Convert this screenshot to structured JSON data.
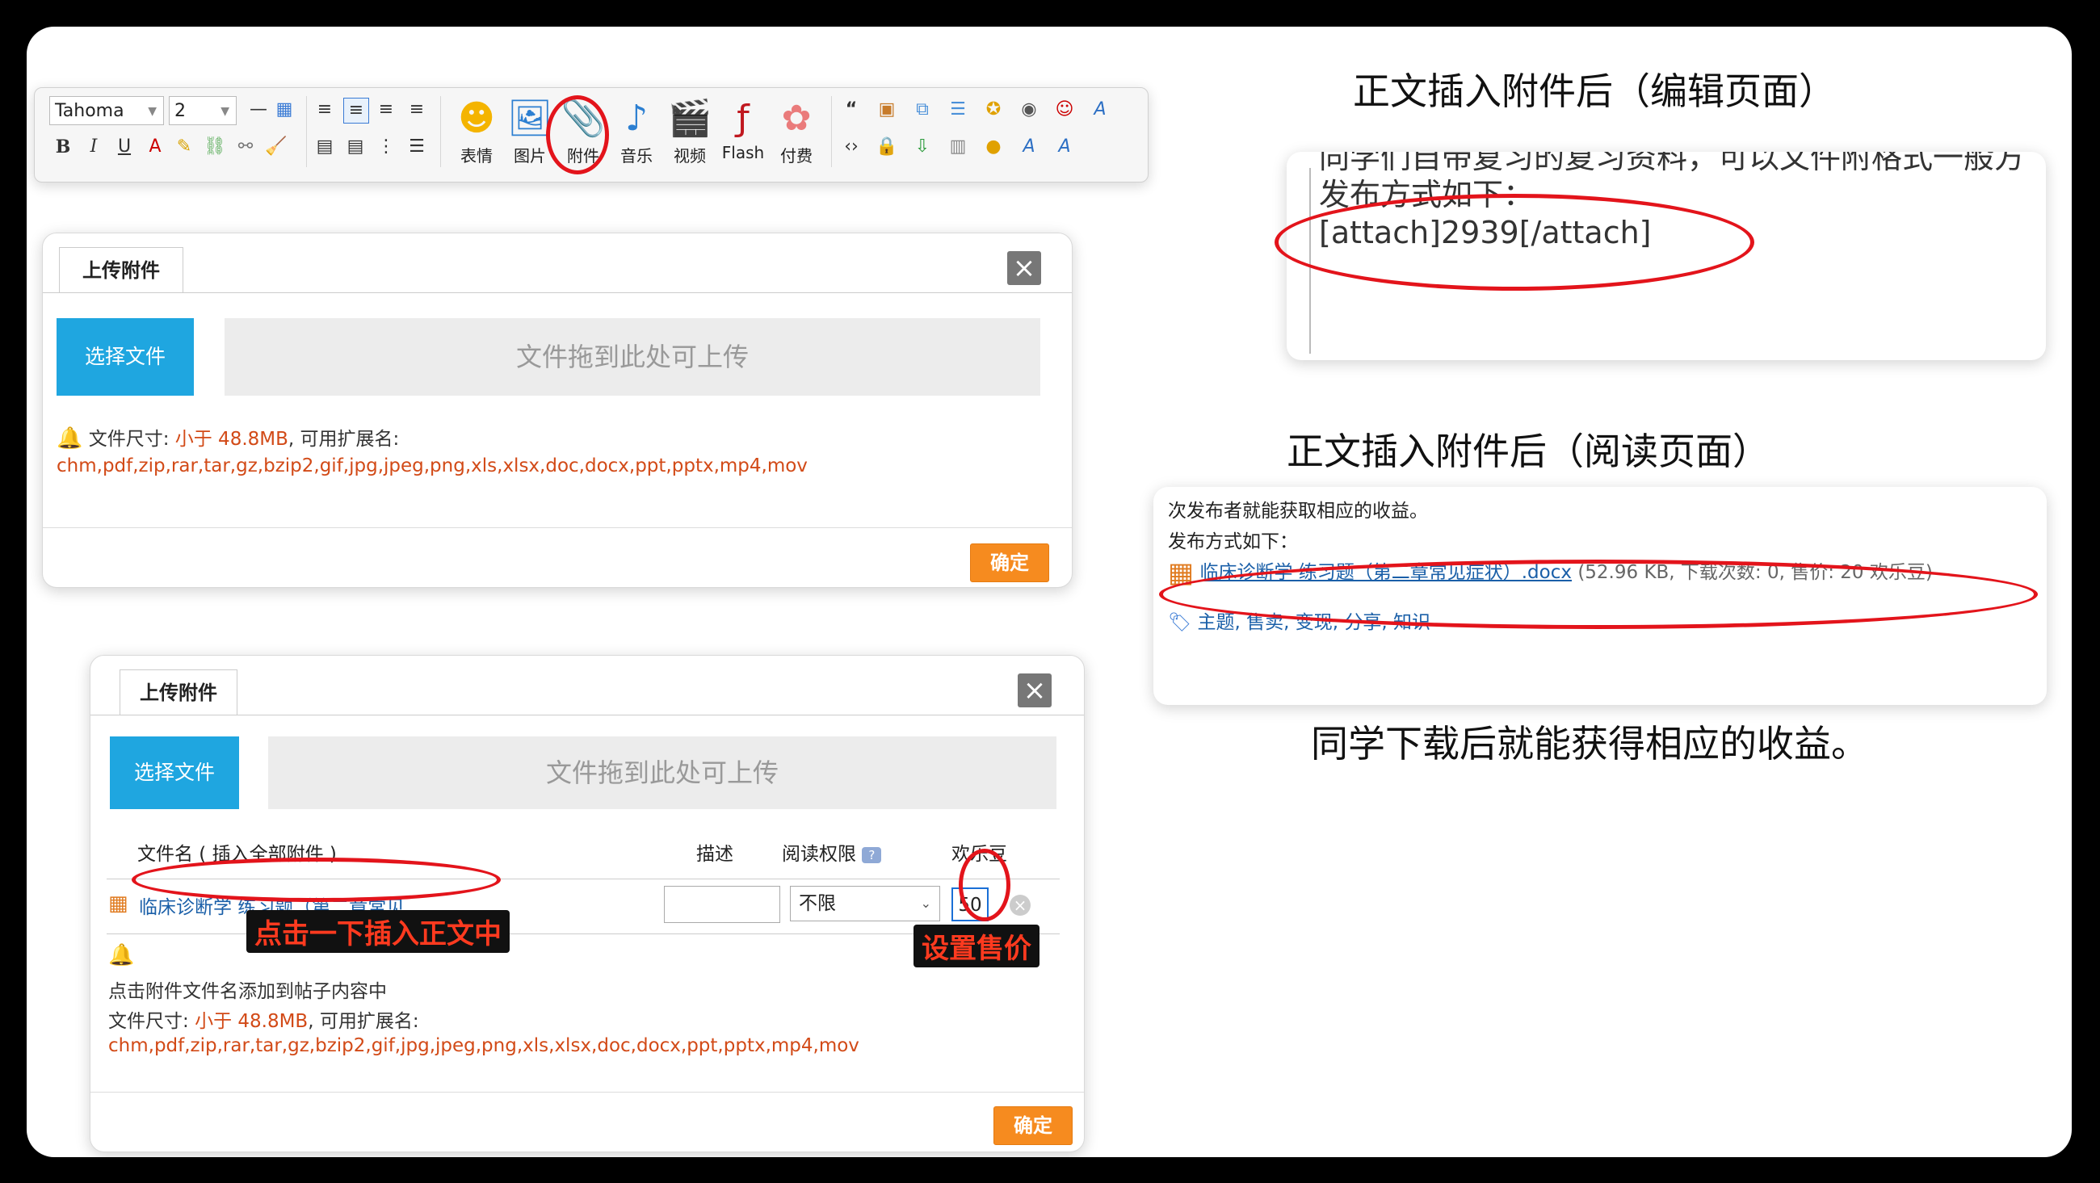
{
  "toolbar": {
    "font_value": "Tahoma",
    "size_value": "2",
    "buttons": [
      {
        "label": "表情",
        "icon": "smiley-icon"
      },
      {
        "label": "图片",
        "icon": "image-icon"
      },
      {
        "label": "附件",
        "icon": "paperclip-icon"
      },
      {
        "label": "音乐",
        "icon": "music-note-icon"
      },
      {
        "label": "视频",
        "icon": "video-icon"
      },
      {
        "label": "Flash",
        "icon": "flash-icon"
      },
      {
        "label": "付费",
        "icon": "paid-icon"
      }
    ]
  },
  "upload_dialog_1": {
    "tab": "上传附件",
    "choose_file": "选择文件",
    "dropzone": "文件拖到此处可上传",
    "size_prefix": "文件尺寸:",
    "size_limit": "小于 48.8MB",
    "ext_prefix": ", 可用扩展名:",
    "extensions": "chm,pdf,zip,rar,tar,gz,bzip2,gif,jpg,jpeg,png,xls,xlsx,doc,docx,ppt,pptx,mp4,mov",
    "ok": "确定"
  },
  "upload_dialog_2": {
    "tab": "上传附件",
    "choose_file": "选择文件",
    "dropzone": "文件拖到此处可上传",
    "columns": {
      "filename": "文件名 ( 插入全部附件 )",
      "desc": "描述",
      "permission": "阅读权限",
      "price": "欢乐豆"
    },
    "file": {
      "name": "临床诊断学 练习题（第二章常见 ...",
      "permission": "不限",
      "price": "50"
    },
    "hint": "点击附件文件名添加到帖子内容中",
    "size_prefix": "文件尺寸:",
    "size_limit": "小于 48.8MB",
    "ext_prefix": ", 可用扩展名:",
    "extensions": "chm,pdf,zip,rar,tar,gz,bzip2,gif,jpg,jpeg,png,xls,xlsx,doc,docx,ppt,pptx,mp4,mov",
    "ok": "确定"
  },
  "annotations": {
    "insert_label": "点击一下插入正文中",
    "price_label": "设置售价"
  },
  "edit_page": {
    "heading": "正文插入附件后（编辑页面）",
    "partial_line": "同学们自带复习的复习资料，可以文件附格式一般方",
    "line2": "发布方式如下：",
    "line3": "[attach]2939[/attach]"
  },
  "read_page": {
    "heading": "正文插入附件后（阅读页面）",
    "line1": "次发布者就能获取相应的收益。",
    "line2": "发布方式如下：",
    "file_link": "临床诊断学 练习题（第二章常见症状）.docx",
    "file_meta": "(52.96 KB, 下载次数: 0, 售价: 20 欢乐豆)",
    "tags": "主题, 售卖, 变现, 分享, 知识"
  },
  "footer_text": "同学下载后就能获得相应的收益。",
  "colors": {
    "accent_blue": "#1fa6e0",
    "ok_orange": "#f68b1f",
    "highlight_red": "#e3141b",
    "link_blue": "#1a5fa8"
  }
}
